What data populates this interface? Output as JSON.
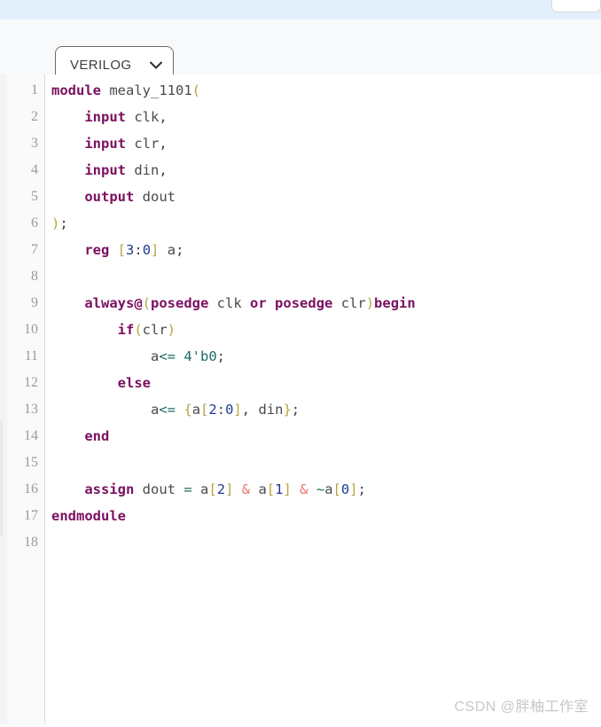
{
  "window": {
    "top_band_color": "#e3effb",
    "background_color": "#ffffff"
  },
  "toolbar": {
    "language_select": {
      "value": "VERILOG",
      "icon": "chevron-down-icon",
      "options": [
        "VERILOG"
      ]
    }
  },
  "editor": {
    "language": "verilog",
    "line_count": 18,
    "line_numbers": [
      "1",
      "2",
      "3",
      "4",
      "5",
      "6",
      "7",
      "8",
      "9",
      "10",
      "11",
      "12",
      "13",
      "14",
      "15",
      "16",
      "17",
      "18"
    ],
    "colors": {
      "keyword": "#7b1060",
      "identifier": "#4a4a4a",
      "punctuation": "#b5a642",
      "number": "#1f3a93",
      "operator": "#1d6b5f",
      "ampersand": "#e8746c",
      "gutter_text": "#9a9a9a",
      "gutter_bg": "#fafafa"
    },
    "lines": [
      {
        "n": "1",
        "text": "module mealy_1101("
      },
      {
        "n": "2",
        "text": "    input clk,"
      },
      {
        "n": "3",
        "text": "    input clr,"
      },
      {
        "n": "4",
        "text": "    input din,"
      },
      {
        "n": "5",
        "text": "    output dout"
      },
      {
        "n": "6",
        "text": ");"
      },
      {
        "n": "7",
        "text": "    reg [3:0] a;"
      },
      {
        "n": "8",
        "text": ""
      },
      {
        "n": "9",
        "text": "    always@(posedge clk or posedge clr)begin"
      },
      {
        "n": "10",
        "text": "        if(clr)"
      },
      {
        "n": "11",
        "text": "            a<= 4'b0;"
      },
      {
        "n": "12",
        "text": "        else"
      },
      {
        "n": "13",
        "text": "            a<= {a[2:0], din};"
      },
      {
        "n": "14",
        "text": "    end"
      },
      {
        "n": "15",
        "text": ""
      },
      {
        "n": "16",
        "text": "    assign dout = a[2] & a[1] & ~a[0];"
      },
      {
        "n": "17",
        "text": "endmodule"
      },
      {
        "n": "18",
        "text": ""
      }
    ]
  },
  "watermark": {
    "text": "CSDN @胖柚工作室"
  }
}
